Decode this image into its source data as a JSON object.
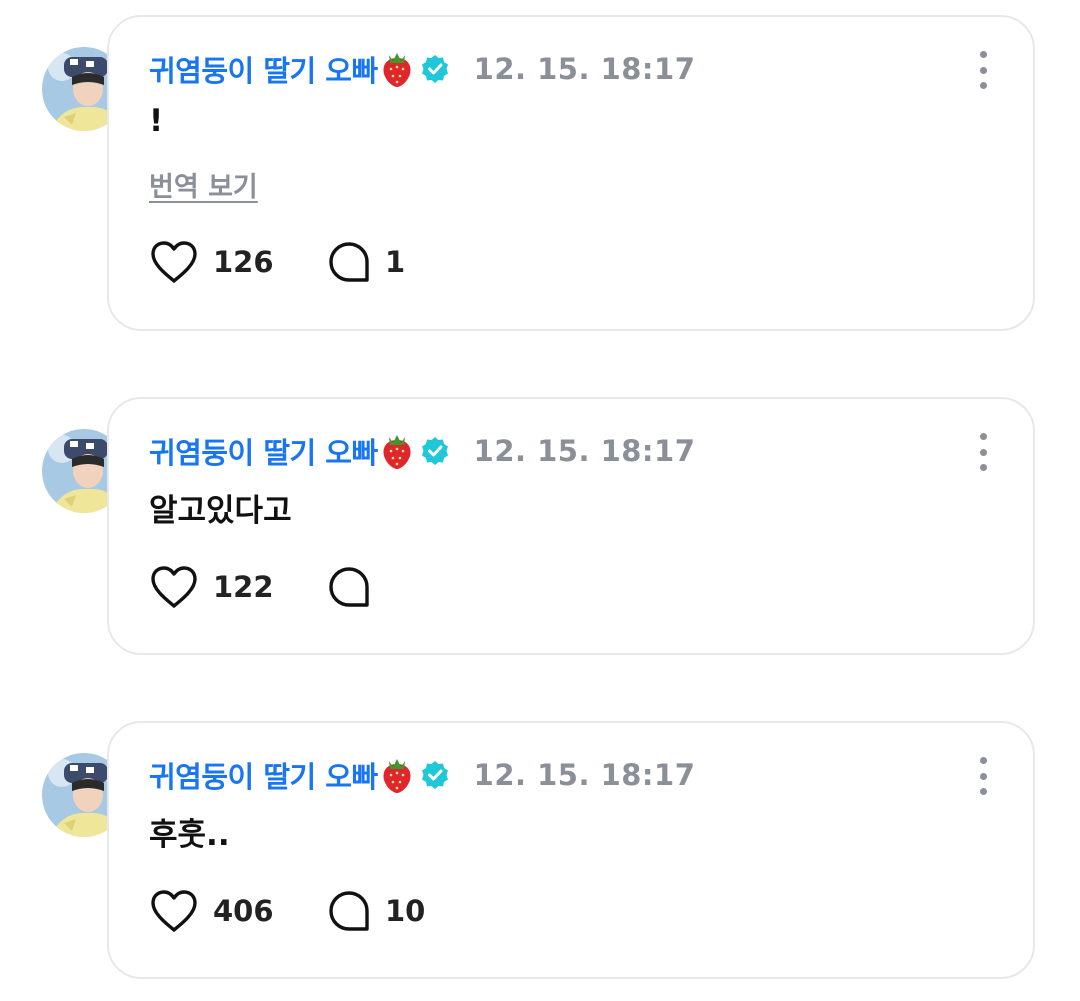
{
  "posts": [
    {
      "author": "귀염둥이 딸기 오빠",
      "timestamp": "12. 15. 18:17",
      "text": "!",
      "translate_label": "번역 보기",
      "likes": "126",
      "comments": "1"
    },
    {
      "author": "귀염둥이 딸기 오빠",
      "timestamp": "12. 15. 18:17",
      "text": "알고있다고",
      "likes": "122",
      "comments": ""
    },
    {
      "author": "귀염둥이 딸기 오빠",
      "timestamp": "12. 15. 18:17",
      "text": "후훗..",
      "likes": "406",
      "comments": "10"
    }
  ],
  "icons": {
    "author_badge": "strawberry-emoji",
    "verified": "verified-check-icon",
    "like": "heart-icon",
    "comment": "comment-bubble-icon",
    "more": "more-vertical-icon"
  },
  "colors": {
    "author_name": "#1976f2",
    "verified_badge": "#1ec8d8",
    "timestamp": "#8a8f98",
    "card_border": "#e6e8ec"
  }
}
